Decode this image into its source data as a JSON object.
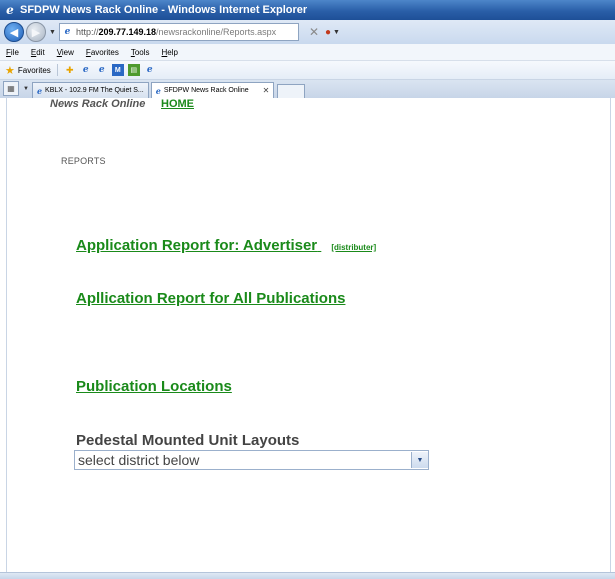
{
  "window": {
    "title": "SFDPW News Rack Online - Windows Internet Explorer"
  },
  "address": {
    "host_prefix": "http://",
    "host": "209.77.149.18",
    "path": "/newsrackonline/Reports.aspx"
  },
  "menu": {
    "items": [
      "File",
      "Edit",
      "View",
      "Favorites",
      "Tools",
      "Help"
    ]
  },
  "favorites": {
    "label": "Favorites"
  },
  "tabs": [
    {
      "label": "KBLX - 102.9 FM The Quiet S...",
      "active": false
    },
    {
      "label": "SFDPW News Rack Online",
      "active": true
    }
  ],
  "page": {
    "brand": "News Rack Online",
    "home_link": "HOME",
    "section_label": "REPORTS",
    "app_report_link": "Application Report for:   Advertiser",
    "app_report_sub": "[distributer]",
    "all_publications_link": "Apllication Report for All Publications",
    "locations_link": "Publication Locations",
    "pedestal_title": "Pedestal Mounted Unit Layouts",
    "district_select_value": "select district below"
  },
  "icons": {
    "ie": "e",
    "close": "✕",
    "star": "★"
  }
}
